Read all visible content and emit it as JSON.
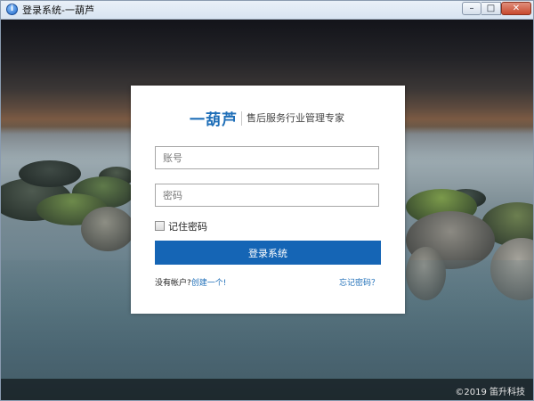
{
  "window": {
    "title": "登录系统-一葫芦",
    "icon": "app-info-icon",
    "controls": {
      "minimize": "minimize-icon",
      "maximize": "maximize-icon",
      "close": "close-icon"
    }
  },
  "brand": {
    "logo_text": "一葫芦",
    "slogan": "售后服务行业管理专家",
    "accent_color": "#1565b5"
  },
  "form": {
    "username_placeholder": "账号",
    "password_placeholder": "密码",
    "remember_label": "记住密码",
    "remember_checked": false,
    "submit_label": "登录系统",
    "no_account_text": "没有帐户?",
    "create_link": "创建一个!",
    "forgot_link": "忘记密码？"
  },
  "footer": {
    "copyright": "©2019 笛升科技"
  }
}
